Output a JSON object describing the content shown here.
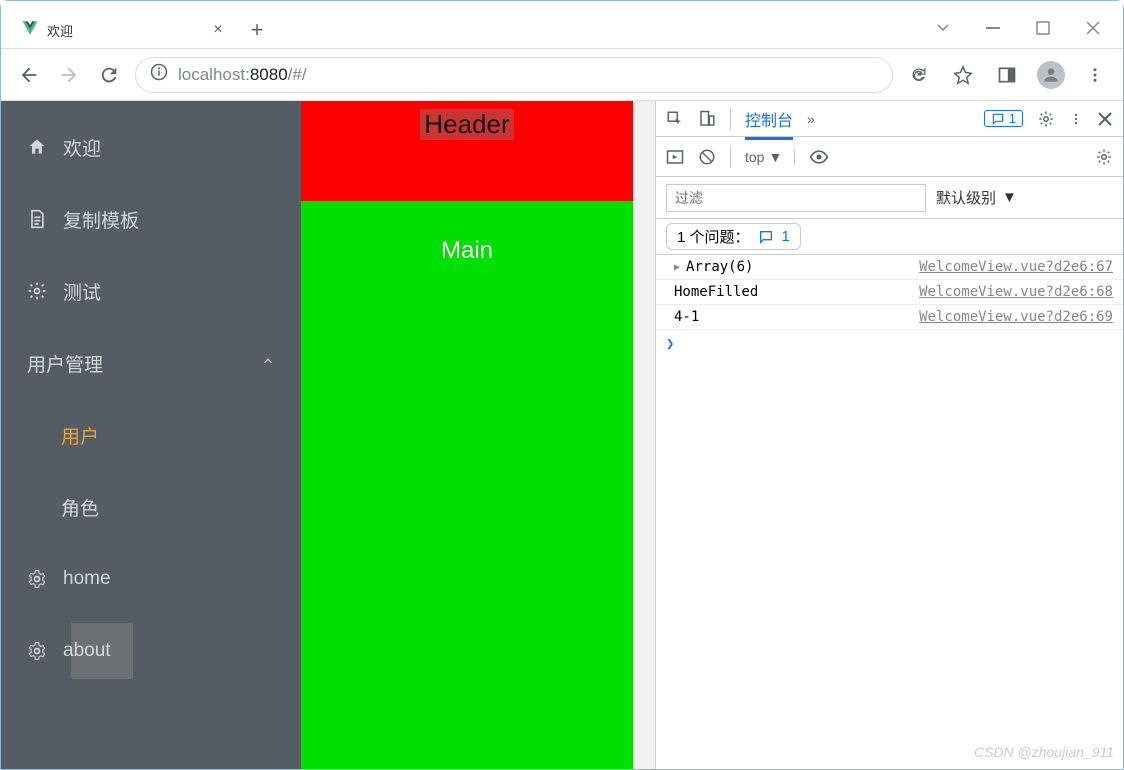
{
  "browser": {
    "tab_title": "欢迎",
    "url_host": "localhost:",
    "url_port": "8080",
    "url_path": "/#/"
  },
  "sidebar": {
    "items": [
      {
        "label": "欢迎",
        "icon": "home-filled-icon"
      },
      {
        "label": "复制模板",
        "icon": "document-icon"
      },
      {
        "label": "测试",
        "icon": "gear-icon"
      },
      {
        "label": "用户管理",
        "icon": "",
        "expandable": true
      },
      {
        "label": "用户",
        "level": 2,
        "active": true
      },
      {
        "label": "角色",
        "level": 2
      },
      {
        "label": "home",
        "icon": "cog-icon"
      },
      {
        "label": "about",
        "icon": "cog-icon",
        "highlight": true
      }
    ]
  },
  "page": {
    "header_text": "Header",
    "main_text": "Main"
  },
  "devtools": {
    "tabs": {
      "console": "控制台",
      "more": "»"
    },
    "issue_count": "1",
    "context": "top",
    "filter_placeholder": "过滤",
    "level_label": "默认级别",
    "issues_label": "1 个问题：",
    "issues_badge": "1",
    "logs": [
      {
        "msg": "Array(6)",
        "caret": true,
        "src": "WelcomeView.vue?d2e6:67"
      },
      {
        "msg": "HomeFilled",
        "src": "WelcomeView.vue?d2e6:68"
      },
      {
        "msg": "4-1",
        "src": "WelcomeView.vue?d2e6:69"
      }
    ]
  },
  "watermark": "CSDN @zhoujian_911"
}
